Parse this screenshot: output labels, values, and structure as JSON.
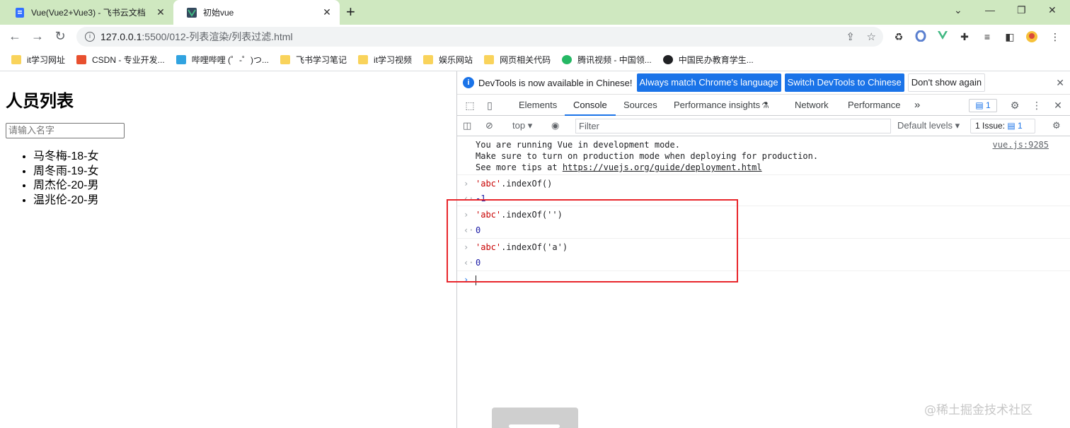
{
  "browser": {
    "tabs": [
      {
        "title": "Vue(Vue2+Vue3) - 飞书云文档",
        "icon": "doc-icon",
        "active": false
      },
      {
        "title": "初始vue",
        "icon": "vue-page-icon",
        "active": true
      }
    ],
    "new_tab": "+",
    "url_host": "127.0.0.1",
    "url_path": ":5500/012-列表渲染/列表过滤.html",
    "bookmarks": [
      {
        "label": "it学习网址",
        "color": "#f9d35b"
      },
      {
        "label": "CSDN - 专业开发...",
        "color": "#e8502f"
      },
      {
        "label": "哔哩哔哩 (゜-゜)つ...",
        "color": "#31a3e0"
      },
      {
        "label": "飞书学习笔记",
        "color": "#f9d35b"
      },
      {
        "label": "it学习视频",
        "color": "#f9d35b"
      },
      {
        "label": "娱乐网站",
        "color": "#f9d35b"
      },
      {
        "label": "网页相关代码",
        "color": "#f9d35b"
      },
      {
        "label": "腾讯视频 - 中国领...",
        "color": "#25b864"
      },
      {
        "label": "中国民办教育学生...",
        "color": "#202124"
      }
    ]
  },
  "page": {
    "heading": "人员列表",
    "search_placeholder": "请输入名字",
    "persons": [
      "马冬梅-18-女",
      "周冬雨-19-女",
      "周杰伦-20-男",
      "温兆伦-20-男"
    ]
  },
  "devtools": {
    "banner": {
      "message": "DevTools is now available in Chinese!",
      "btn_match": "Always match Chrome's language",
      "btn_switch": "Switch DevTools to Chinese",
      "btn_dismiss": "Don't show again"
    },
    "tabs": [
      "Elements",
      "Console",
      "Sources",
      "Performance insights",
      "Network",
      "Performance"
    ],
    "active_tab": "Console",
    "message_count": "1",
    "context": "top",
    "filter_placeholder": "Filter",
    "levels": "Default levels",
    "issues_label": "1 Issue:",
    "issues_count": "1",
    "vue_msg_1": "You are running Vue in development mode.",
    "vue_msg_2": "Make sure to turn on production mode when deploying for production.",
    "vue_msg_3_prefix": "See more tips at ",
    "vue_msg_3_link": "https://vuejs.org/guide/deployment.html",
    "vue_source": "vue.js:9285",
    "entries": [
      {
        "str": "'abc'",
        "rest": ".indexOf()",
        "result": "-1"
      },
      {
        "str": "'abc'",
        "rest": ".indexOf('')",
        "result": "0"
      },
      {
        "str": "'abc'",
        "rest": ".indexOf('a')",
        "result": "0"
      }
    ]
  },
  "watermark": "@稀土掘金技术社区"
}
